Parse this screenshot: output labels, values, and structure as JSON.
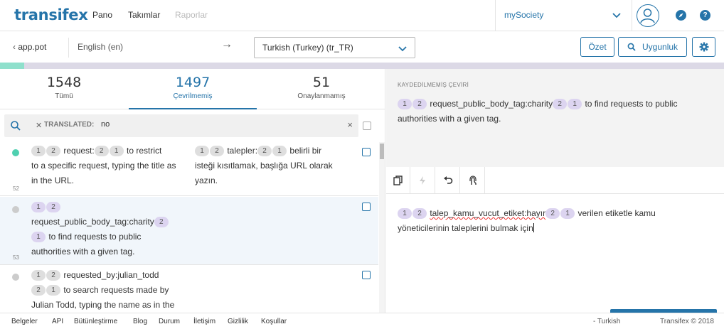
{
  "nav": {
    "logo": "transifex",
    "links": [
      "Pano",
      "Takımlar",
      "Raporlar"
    ],
    "org": "mySociety"
  },
  "toolbar": {
    "back": "app.pot",
    "source_lang": "English (en)",
    "arrow": "→",
    "target_lang": "Turkish (Turkey) (tr_TR)",
    "summary_btn": "Özet",
    "check_btn": "Uygunluk"
  },
  "progress": {
    "translated_fraction": 0.033
  },
  "stats": [
    {
      "num": "1548",
      "label": "Tümü"
    },
    {
      "num": "1497",
      "label": "Çevrilmemiş"
    },
    {
      "num": "51",
      "label": "Onaylanmamış"
    }
  ],
  "filter": {
    "key": "TRANSLATED:",
    "value": "no"
  },
  "rows": [
    {
      "num": "52",
      "status": "translated",
      "src_tags": [
        "1",
        "2"
      ],
      "src_mid": "request:",
      "src_tags2": [
        "2",
        "1"
      ],
      "src_rest": "to restrict",
      "src_line2": "to a specific request, typing the title as",
      "src_line3": "in the URL.",
      "tr_tags": [
        "1",
        "2"
      ],
      "tr_mid": "talepler:",
      "tr_tags2": [
        "2",
        "1"
      ],
      "tr_rest": "belirli bir",
      "tr_line2": "isteği kısıtlamak, başlığa URL olarak",
      "tr_line3": "yazın."
    },
    {
      "num": "53",
      "status": "untranslated",
      "src_tags": [
        "1",
        "2"
      ],
      "src_line2": "request_public_body_tag:charity",
      "src_tag_end": "2",
      "src_tag_start3": "1",
      "src_line3": "to find requests to public",
      "src_line4": "authorities with a given tag."
    },
    {
      "status": "untranslated",
      "src_tags": [
        "1",
        "2"
      ],
      "src_mid": "requested_by:julian_todd",
      "src_tags2": [
        "2",
        "1"
      ],
      "src_line2": "to search requests made by",
      "src_line3": "Julian Todd, typing the name as in the"
    }
  ],
  "editor": {
    "label": "KAYDEDİLMEMİŞ ÇEVİRİ",
    "orig_tags": [
      "1",
      "2"
    ],
    "orig_mid": "request_public_body_tag:charity",
    "orig_tags2": [
      "2",
      "1"
    ],
    "orig_rest": "to find requests to public",
    "orig_line2": "authorities with a given tag.",
    "trans_tags": [
      "1",
      "2"
    ],
    "trans_mid": "talep_kamu_vucut_etiket:hayır",
    "trans_tags2": [
      "2",
      "1"
    ],
    "trans_rest": "verilen etiketle kamu",
    "trans_line2": "yöneticilerinin taleplerini bulmak için"
  },
  "footer": {
    "links": [
      "Belgeler",
      "API",
      "Bütünleştirme",
      "Blog",
      "Durum",
      "İletişim",
      "Gizlilik",
      "Koşullar"
    ],
    "lang": "- Turkish",
    "copyright": "Transifex © 2018"
  },
  "colors": {
    "brand": "#2574a9",
    "progress": "#8fe0cc",
    "translated_dot": "#4fd0b0"
  }
}
